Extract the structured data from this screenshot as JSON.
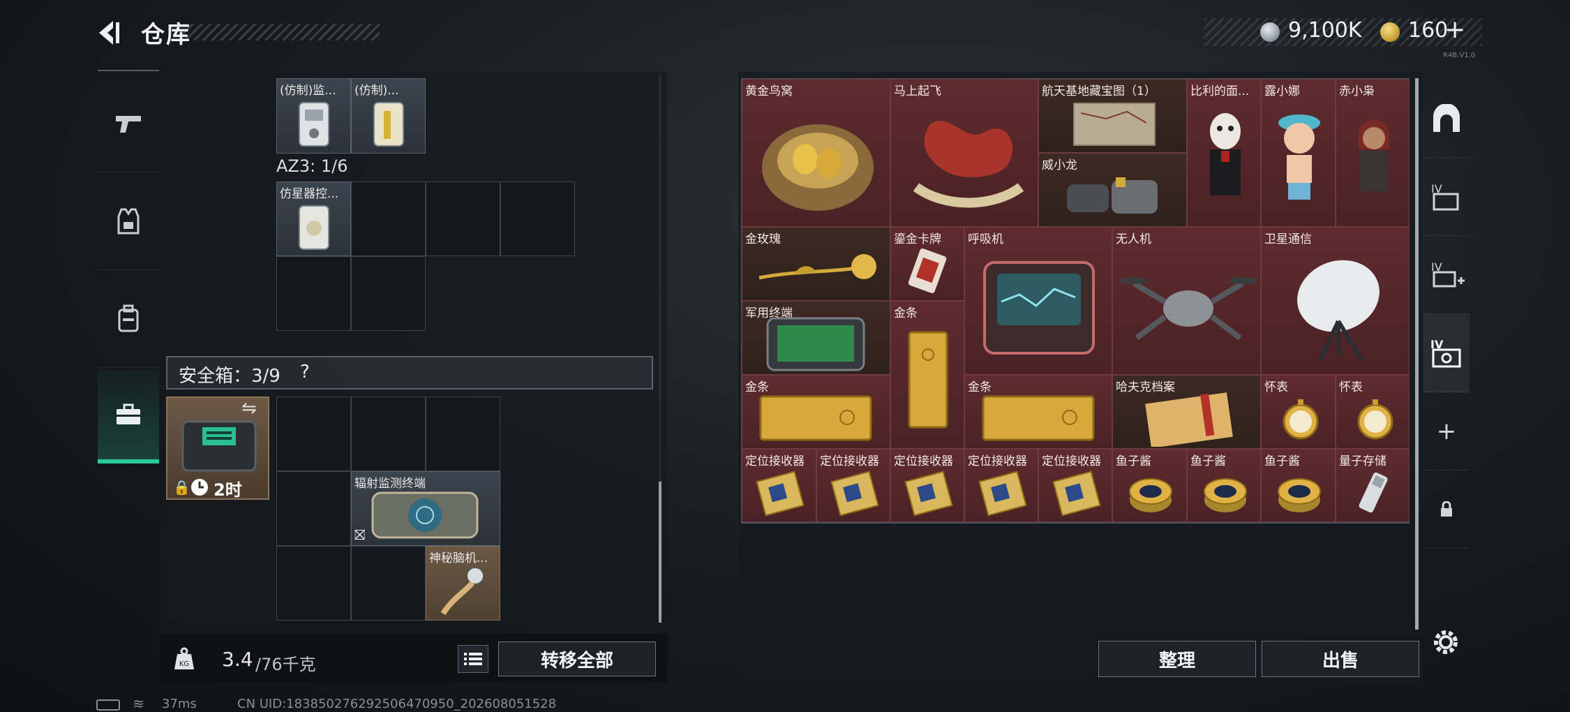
{
  "header": {
    "title": "仓库"
  },
  "currency": {
    "silver": "9,100K",
    "gold": "160",
    "plus": "+",
    "version": "R4B.V1.0"
  },
  "nav": {
    "items": [
      "weapon",
      "armor",
      "backpack",
      "safebox"
    ]
  },
  "left": {
    "top_items": [
      {
        "label": "(仿制)监..."
      },
      {
        "label": "(仿制)..."
      }
    ],
    "az3_label": "AZ3: 1/6",
    "az3_item": {
      "label": "仿星器控..."
    },
    "safebox_title": "安全箱：3/9",
    "safebox_help": "?",
    "safebox_timer": "2时",
    "safebox_items": [
      {
        "label": "辐射监测终端"
      },
      {
        "label": "神秘脑机..."
      }
    ],
    "weight_current": "3.4",
    "weight_max": "/76千克",
    "transfer_all": "转移全部"
  },
  "warehouse": {
    "items": [
      {
        "label": "黄金鸟窝"
      },
      {
        "label": "马上起飞"
      },
      {
        "label": "航天基地藏宝图（1）"
      },
      {
        "label": "比利的面..."
      },
      {
        "label": "露小娜"
      },
      {
        "label": "赤小枭"
      },
      {
        "label": "威小龙"
      },
      {
        "label": "金玫瑰"
      },
      {
        "label": "鎏金卡牌"
      },
      {
        "label": "呼吸机"
      },
      {
        "label": "无人机"
      },
      {
        "label": "卫星通信"
      },
      {
        "label": "军用终端"
      },
      {
        "label": "金条"
      },
      {
        "label": "金条"
      },
      {
        "label": "金条"
      },
      {
        "label": "哈夫克档案"
      },
      {
        "label": "怀表"
      },
      {
        "label": "怀表"
      },
      {
        "label": "定位接收器"
      },
      {
        "label": "定位接收器"
      },
      {
        "label": "定位接收器"
      },
      {
        "label": "定位接收器"
      },
      {
        "label": "定位接收器"
      },
      {
        "label": "鱼子酱"
      },
      {
        "label": "鱼子酱"
      },
      {
        "label": "鱼子酱"
      },
      {
        "label": "量子存储"
      }
    ],
    "sort": "整理",
    "sell": "出售"
  },
  "right_tabs": [
    "IV",
    "IV",
    "IV",
    "+"
  ],
  "status": {
    "ping": "37ms",
    "uid": "CN UID:183850276292506470950_202608051528"
  },
  "colors": {
    "accent": "#28c99a",
    "item_red": "#5f2b2e",
    "gold": "#d4a93a"
  }
}
